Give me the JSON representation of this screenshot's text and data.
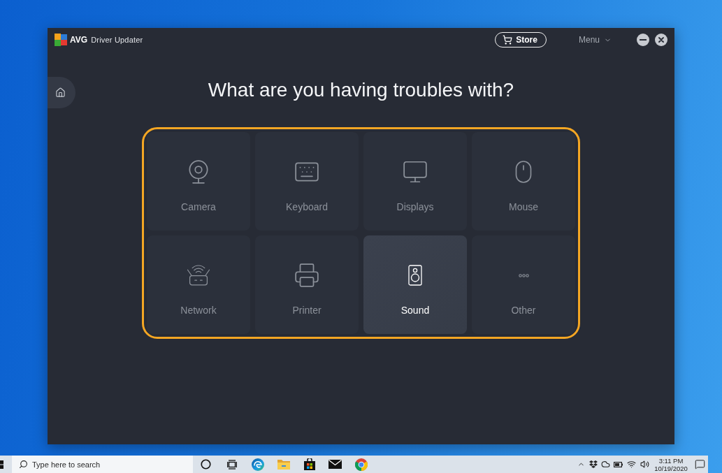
{
  "app": {
    "brand": "AVG",
    "title": "Driver Updater",
    "store_button": "Store",
    "menu": "Menu"
  },
  "heading": "What are you having troubles with?",
  "categories": [
    {
      "label": "Camera",
      "selected": false
    },
    {
      "label": "Keyboard",
      "selected": false
    },
    {
      "label": "Displays",
      "selected": false
    },
    {
      "label": "Mouse",
      "selected": false
    },
    {
      "label": "Network",
      "selected": false
    },
    {
      "label": "Printer",
      "selected": false
    },
    {
      "label": "Sound",
      "selected": true
    },
    {
      "label": "Other",
      "selected": false
    }
  ],
  "taskbar": {
    "search": {
      "placeholder": "Type here to search"
    },
    "clock": {
      "time": "3:11 PM",
      "date": "10/19/2020"
    }
  }
}
